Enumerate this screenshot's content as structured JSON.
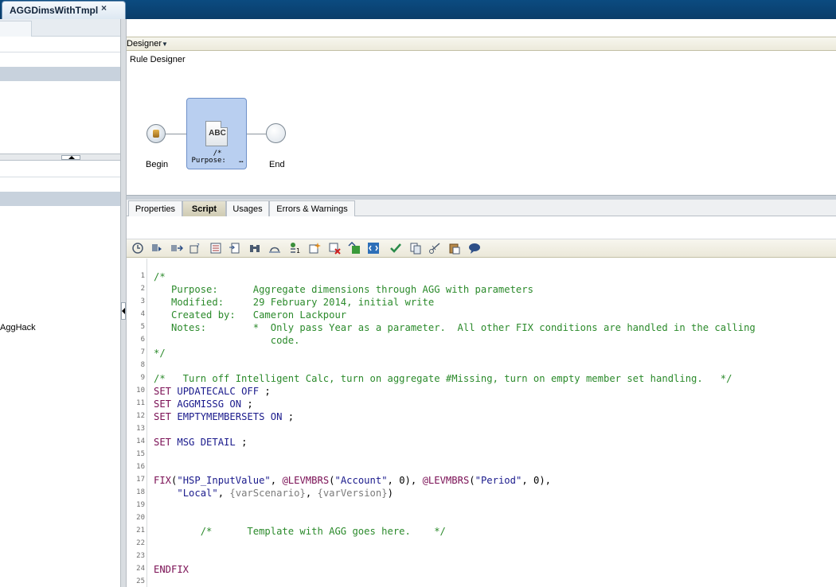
{
  "document_tab": {
    "title": "AGGDimsWithTmpl",
    "close_glyph": "×"
  },
  "left_pane": {
    "member_label": "AggHack"
  },
  "designer": {
    "header_label": "Designer",
    "canvas_title": "Rule Designer",
    "nodes": {
      "begin": "Begin",
      "script_icon_text": "ABC",
      "script_label": "/*\nPurpose:   …",
      "end": "End"
    }
  },
  "property_tabs": [
    "Properties",
    "Script",
    "Usages",
    "Errors & Warnings"
  ],
  "active_tab": "Script",
  "toolbar_icons": [
    "validate-icon",
    "script-member-icon",
    "insert-function-icon",
    "variables-icon",
    "smart-lists-icon",
    "templates-icon",
    "find-icon",
    "replace-icon",
    "member-range-icon",
    "insert-comment-icon",
    "remove-comment-icon",
    "check-syntax-icon",
    "show-all-icon",
    "approve-icon",
    "copy-icon",
    "cut-icon",
    "paste-icon",
    "help-icon"
  ],
  "script": {
    "line_numbers": [
      "1",
      "2",
      "3",
      "4",
      "5",
      "6",
      "7",
      "8",
      "9",
      "10",
      "11",
      "12",
      "13",
      "14",
      "15",
      "16",
      "17",
      "18",
      "19",
      "20",
      "21",
      "22",
      "23",
      "24",
      "25"
    ],
    "lines": [
      [
        {
          "t": "/*",
          "c": "c-com"
        }
      ],
      [
        {
          "t": "   Purpose:      Aggregate dimensions through AGG with parameters",
          "c": "c-com"
        }
      ],
      [
        {
          "t": "   Modified:     29 February 2014, initial write",
          "c": "c-com"
        }
      ],
      [
        {
          "t": "   Created by:   Cameron Lackpour",
          "c": "c-com"
        }
      ],
      [
        {
          "t": "   Notes:        *  Only pass Year as a parameter.  All other FIX conditions are handled in the calling",
          "c": "c-com"
        }
      ],
      [
        {
          "t": "                    code.",
          "c": "c-com"
        }
      ],
      [
        {
          "t": "*/",
          "c": "c-com"
        }
      ],
      [],
      [
        {
          "t": "/*   Turn off Intelligent Calc, turn on aggregate #Missing, turn on empty member set handling.   */",
          "c": "c-com"
        }
      ],
      [
        {
          "t": "SET ",
          "c": "c-kw"
        },
        {
          "t": "UPDATECALC OFF",
          "c": "c-kw2"
        },
        {
          "t": " ;",
          "c": "c-plain"
        }
      ],
      [
        {
          "t": "SET ",
          "c": "c-kw"
        },
        {
          "t": "AGGMISSG ON",
          "c": "c-kw2"
        },
        {
          "t": " ;",
          "c": "c-plain"
        }
      ],
      [
        {
          "t": "SET ",
          "c": "c-kw"
        },
        {
          "t": "EMPTYMEMBERSETS ON",
          "c": "c-kw2"
        },
        {
          "t": " ;",
          "c": "c-plain"
        }
      ],
      [],
      [
        {
          "t": "SET ",
          "c": "c-kw"
        },
        {
          "t": "MSG DETAIL",
          "c": "c-kw2"
        },
        {
          "t": " ;",
          "c": "c-plain"
        }
      ],
      [],
      [],
      [
        {
          "t": "FIX",
          "c": "c-fn"
        },
        {
          "t": "(",
          "c": "c-plain"
        },
        {
          "t": "\"HSP_InputValue\"",
          "c": "c-str"
        },
        {
          "t": ", ",
          "c": "c-plain"
        },
        {
          "t": "@LEVMBRS",
          "c": "c-fn"
        },
        {
          "t": "(",
          "c": "c-plain"
        },
        {
          "t": "\"Account\"",
          "c": "c-str"
        },
        {
          "t": ", 0), ",
          "c": "c-plain"
        },
        {
          "t": "@LEVMBRS",
          "c": "c-fn"
        },
        {
          "t": "(",
          "c": "c-plain"
        },
        {
          "t": "\"Period\"",
          "c": "c-str"
        },
        {
          "t": ", 0),",
          "c": "c-plain"
        }
      ],
      [
        {
          "t": "    ",
          "c": "c-plain"
        },
        {
          "t": "\"Local\"",
          "c": "c-str"
        },
        {
          "t": ", ",
          "c": "c-plain"
        },
        {
          "t": "{varScenario}",
          "c": "c-var"
        },
        {
          "t": ", ",
          "c": "c-plain"
        },
        {
          "t": "{varVersion}",
          "c": "c-var"
        },
        {
          "t": ")",
          "c": "c-plain"
        }
      ],
      [],
      [],
      [
        {
          "t": "        /*      Template with AGG goes here.    */",
          "c": "c-com"
        }
      ],
      [],
      [],
      [
        {
          "t": "ENDFIX",
          "c": "c-fn"
        }
      ],
      []
    ]
  }
}
